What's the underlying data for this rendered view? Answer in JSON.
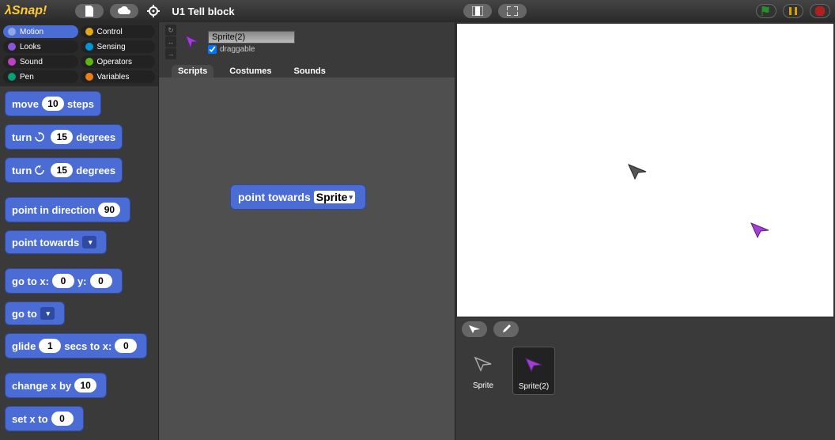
{
  "topbar": {
    "logo_text": "Snap!",
    "project_title": "U1 Tell block"
  },
  "categories": [
    {
      "name": "Motion",
      "color": "#4a6cd4",
      "selected": true
    },
    {
      "name": "Control",
      "color": "#e1a91a"
    },
    {
      "name": "Looks",
      "color": "#8a55d7"
    },
    {
      "name": "Sensing",
      "color": "#0494dc"
    },
    {
      "name": "Sound",
      "color": "#bb42c3"
    },
    {
      "name": "Operators",
      "color": "#5cb712"
    },
    {
      "name": "Pen",
      "color": "#00a178"
    },
    {
      "name": "Variables",
      "color": "#ee7d16"
    }
  ],
  "palette": {
    "move_label_a": "move",
    "move_val": "10",
    "move_label_b": "steps",
    "turn_cw_a": "turn",
    "turn_cw_val": "15",
    "turn_cw_b": "degrees",
    "turn_ccw_a": "turn",
    "turn_ccw_val": "15",
    "turn_ccw_b": "degrees",
    "point_dir_a": "point in direction",
    "point_dir_val": "90",
    "point_towards": "point towards",
    "goto_a": "go to x:",
    "goto_x": "0",
    "goto_b": "y:",
    "goto_y": "0",
    "goto_menu": "go to",
    "glide_a": "glide",
    "glide_secs": "1",
    "glide_b": "secs to x:",
    "glide_x": "0",
    "change_x_a": "change x by",
    "change_x_val": "10",
    "set_x_a": "set x to",
    "set_x_val": "0"
  },
  "sprite_info": {
    "name": "Sprite(2)",
    "draggable_label": "draggable"
  },
  "tabs": {
    "scripts": "Scripts",
    "costumes": "Costumes",
    "sounds": "Sounds"
  },
  "script": {
    "label": "point towards",
    "target": "Sprite"
  },
  "corral": {
    "sprite": "Sprite",
    "sprite2": "Sprite(2)"
  }
}
